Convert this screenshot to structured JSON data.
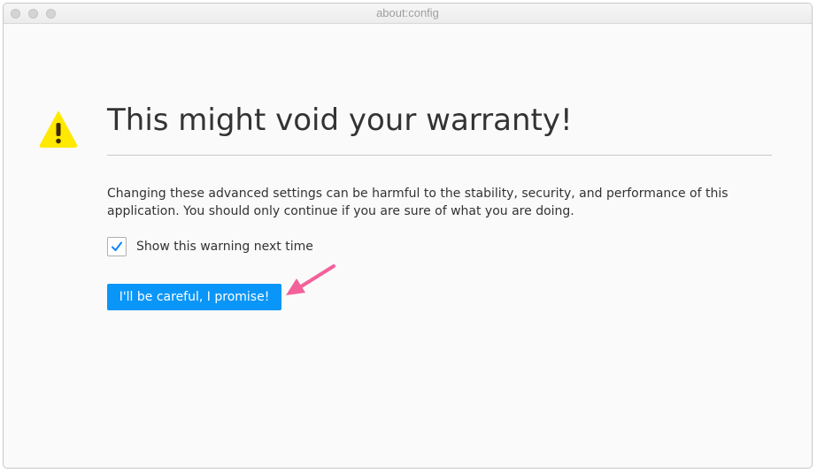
{
  "window": {
    "title": "about:config"
  },
  "warning": {
    "heading": "This might void your warranty!",
    "message": "Changing these advanced settings can be harmful to the stability, security, and performance of this application. You should only continue if you are sure of what you are doing.",
    "icon": "warning-triangle-icon"
  },
  "checkbox": {
    "label": "Show this warning next time",
    "checked": true
  },
  "button": {
    "label": "I'll be careful, I promise!"
  },
  "colors": {
    "accent": "#0996f8",
    "warning": "#ffe900",
    "annotation": "#f2619a"
  }
}
